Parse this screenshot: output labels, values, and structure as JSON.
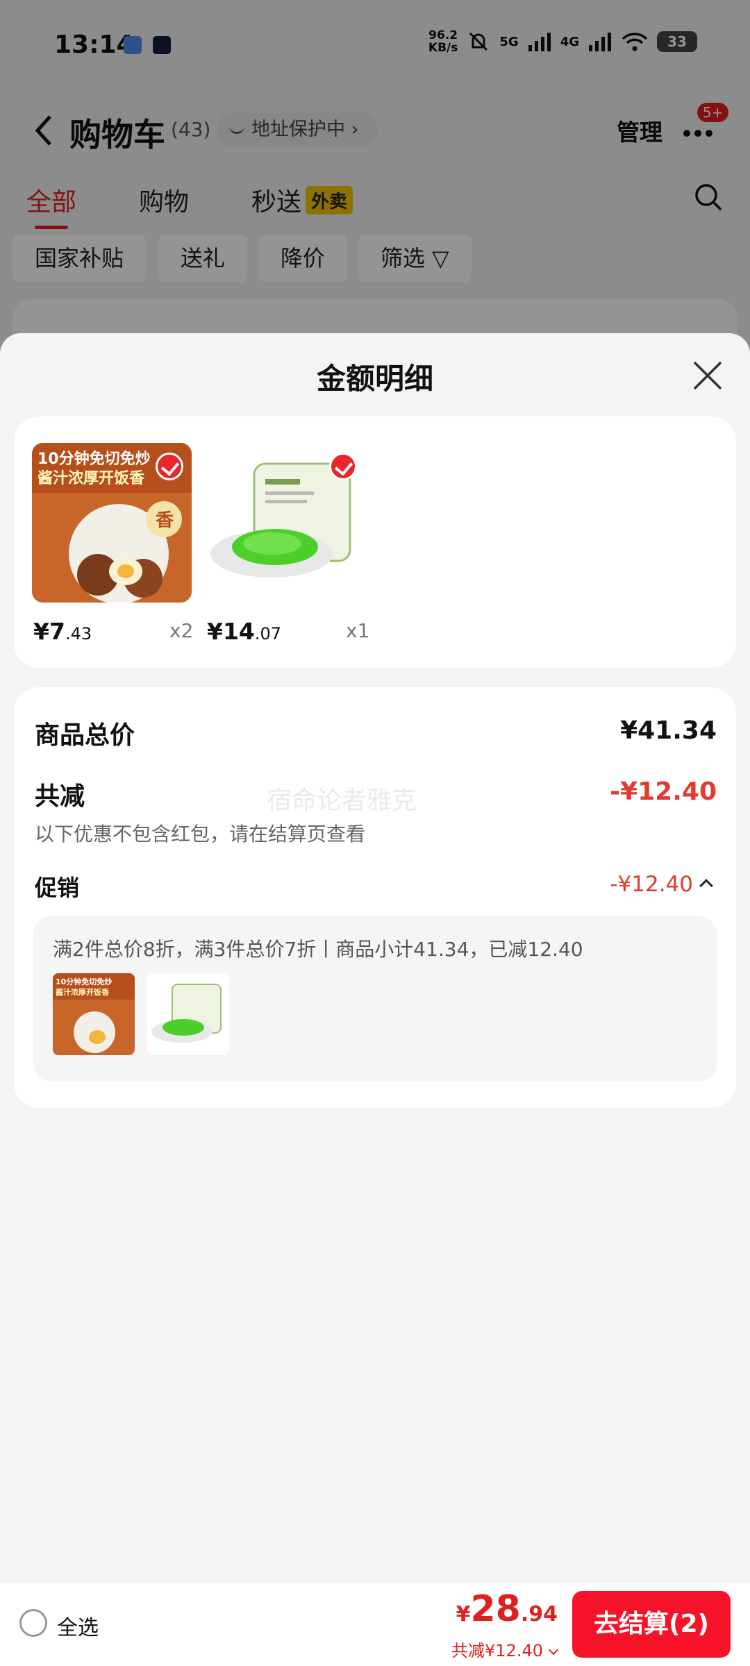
{
  "status_bar": {
    "time": "13:14",
    "net_speed_value": "96.2",
    "net_speed_unit": "KB/s",
    "sim1_label": "5G",
    "sim2_label": "4G",
    "battery": "33"
  },
  "header": {
    "title": "购物车",
    "count": "(43)",
    "address_badge": "地址保护中 ›",
    "manage_label": "管理",
    "more_badge": "5+"
  },
  "tabs": [
    {
      "label": "全部",
      "active": true
    },
    {
      "label": "购物",
      "active": false
    },
    {
      "label": "秒送",
      "badge": "外卖",
      "active": false
    }
  ],
  "chips": [
    "国家补贴",
    "送礼",
    "降价",
    "筛选 ▽"
  ],
  "sheet": {
    "title": "金额明细",
    "goods": [
      {
        "price_int": "¥7",
        "price_dec": ".43",
        "qty": "x2",
        "image_text": "10分钟免切免炒 酱汁浓厚开饭香"
      },
      {
        "price_int": "¥14",
        "price_dec": ".07",
        "qty": "x1",
        "image_text": ""
      }
    ],
    "total_label": "商品总价",
    "total_value": "¥41.34",
    "discount_label": "共减",
    "discount_value": "-¥12.40",
    "discount_note": "以下优惠不包含红包，请在结算页查看",
    "promo_label": "促销",
    "promo_value": "-¥12.40",
    "promo_desc": "满2件总价8折，满3件总价7折丨商品小计41.34，已减12.40",
    "watermark": "宿命论者雅克"
  },
  "bottom_bar": {
    "select_all_label": "全选",
    "total_currency": "¥",
    "total_int": "28",
    "total_dec": ".94",
    "saving_text": "共减¥12.40",
    "checkout_label": "去结算(2)"
  },
  "colors": {
    "accent_red": "#e01f1f",
    "checkout_red": "#f5132a",
    "tab_badge_yellow": "#f5c400"
  }
}
